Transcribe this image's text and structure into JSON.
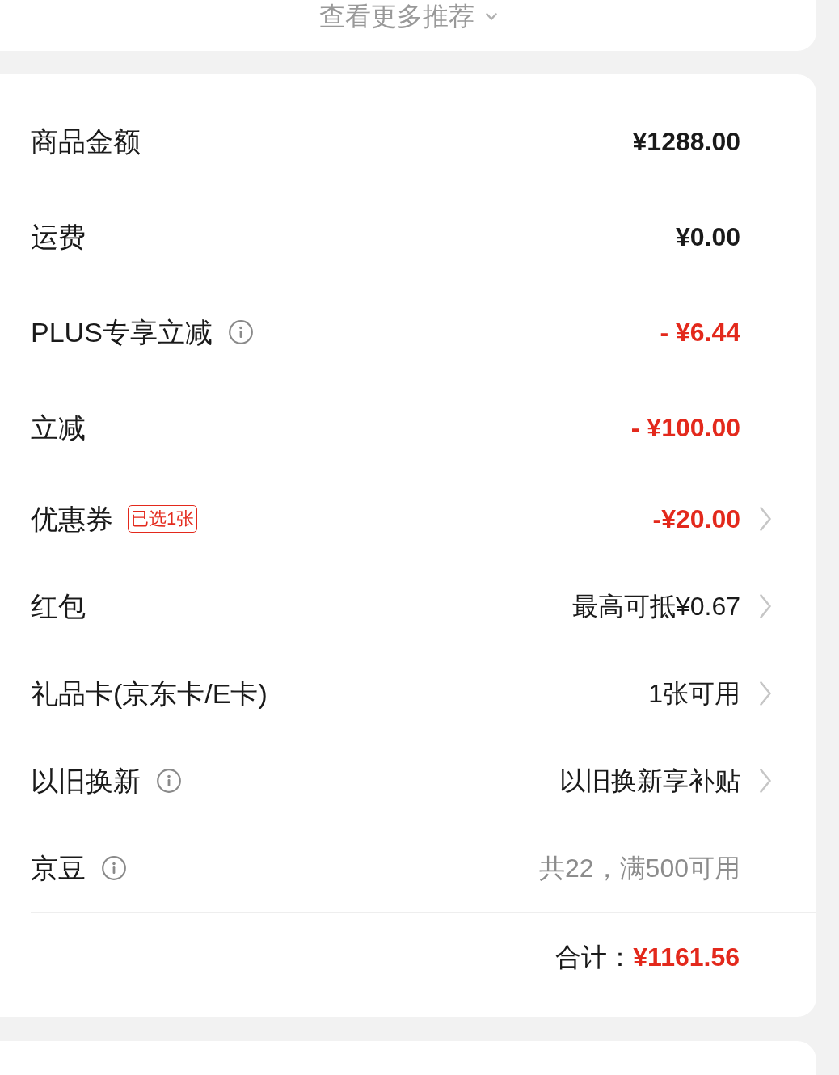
{
  "more_recommendations": {
    "label": "查看更多推荐"
  },
  "summary": {
    "rows": [
      {
        "label": "商品金额",
        "kind": "amount",
        "value": "¥1288.00",
        "info": false,
        "chevron": false
      },
      {
        "label": "运费",
        "kind": "amount",
        "value": "¥0.00",
        "info": false,
        "chevron": false
      },
      {
        "label": "PLUS专享立减",
        "kind": "discount",
        "value": "- ¥6.44",
        "info": true,
        "chevron": false
      },
      {
        "label": "立减",
        "kind": "discount",
        "value": "- ¥100.00",
        "info": false,
        "chevron": false
      },
      {
        "label": "优惠券",
        "badge": "已选1张",
        "kind": "discount",
        "value": "-¥20.00",
        "info": false,
        "chevron": true
      },
      {
        "label": "红包",
        "kind": "option",
        "value": "最高可抵¥0.67",
        "info": false,
        "chevron": true
      },
      {
        "label": "礼品卡(京东卡/E卡)",
        "kind": "option",
        "value": "1张可用",
        "info": false,
        "chevron": true
      },
      {
        "label": "以旧换新",
        "kind": "option",
        "value": "以旧换新享补贴",
        "info": true,
        "chevron": true
      },
      {
        "label": "京豆",
        "kind": "hint",
        "value": "共22，满500可用",
        "info": true,
        "chevron": false
      }
    ],
    "total": {
      "label": "合计：",
      "value": "¥1161.56"
    }
  }
}
